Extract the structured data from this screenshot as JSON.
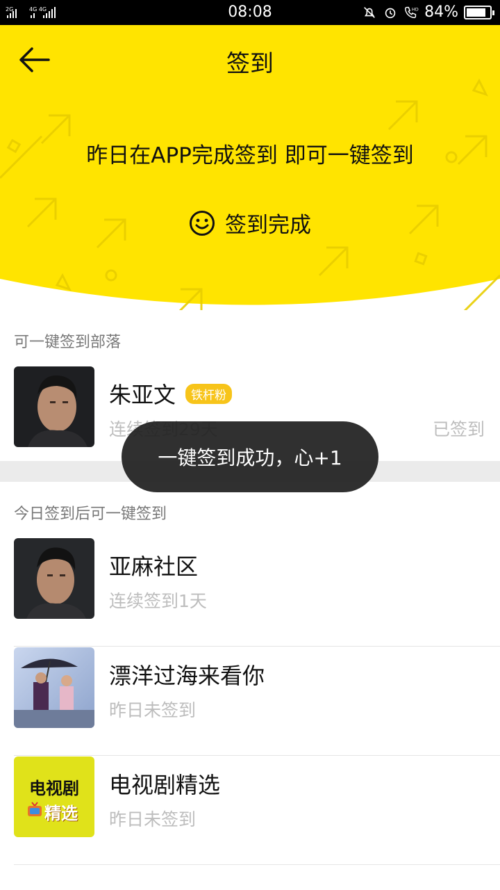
{
  "status_bar": {
    "network": "2G 4G 4G",
    "time": "08:08",
    "battery": "84%",
    "battery_level": 0.84
  },
  "header": {
    "title": "签到",
    "hint": "昨日在APP完成签到 即可一键签到",
    "done_label": "签到完成"
  },
  "section1": {
    "label": "可一键签到部落",
    "items": [
      {
        "name": "朱亚文",
        "badge": "铁杆粉",
        "sub": "连续签到29天",
        "status": "已签到"
      }
    ]
  },
  "section2": {
    "label": "今日签到后可一键签到",
    "items": [
      {
        "name": "亚麻社区",
        "sub": "连续签到1天"
      },
      {
        "name": "漂洋过海来看你",
        "sub": "昨日未签到"
      },
      {
        "name": "电视剧精选",
        "sub": "昨日未签到",
        "logo_line1": "电视剧",
        "logo_line2": "精选"
      }
    ]
  },
  "toast": "一键签到成功，心+1",
  "colors": {
    "accent": "#ffe400",
    "toast_bg": "#1e1e1e",
    "badge": "#f7c41a"
  }
}
